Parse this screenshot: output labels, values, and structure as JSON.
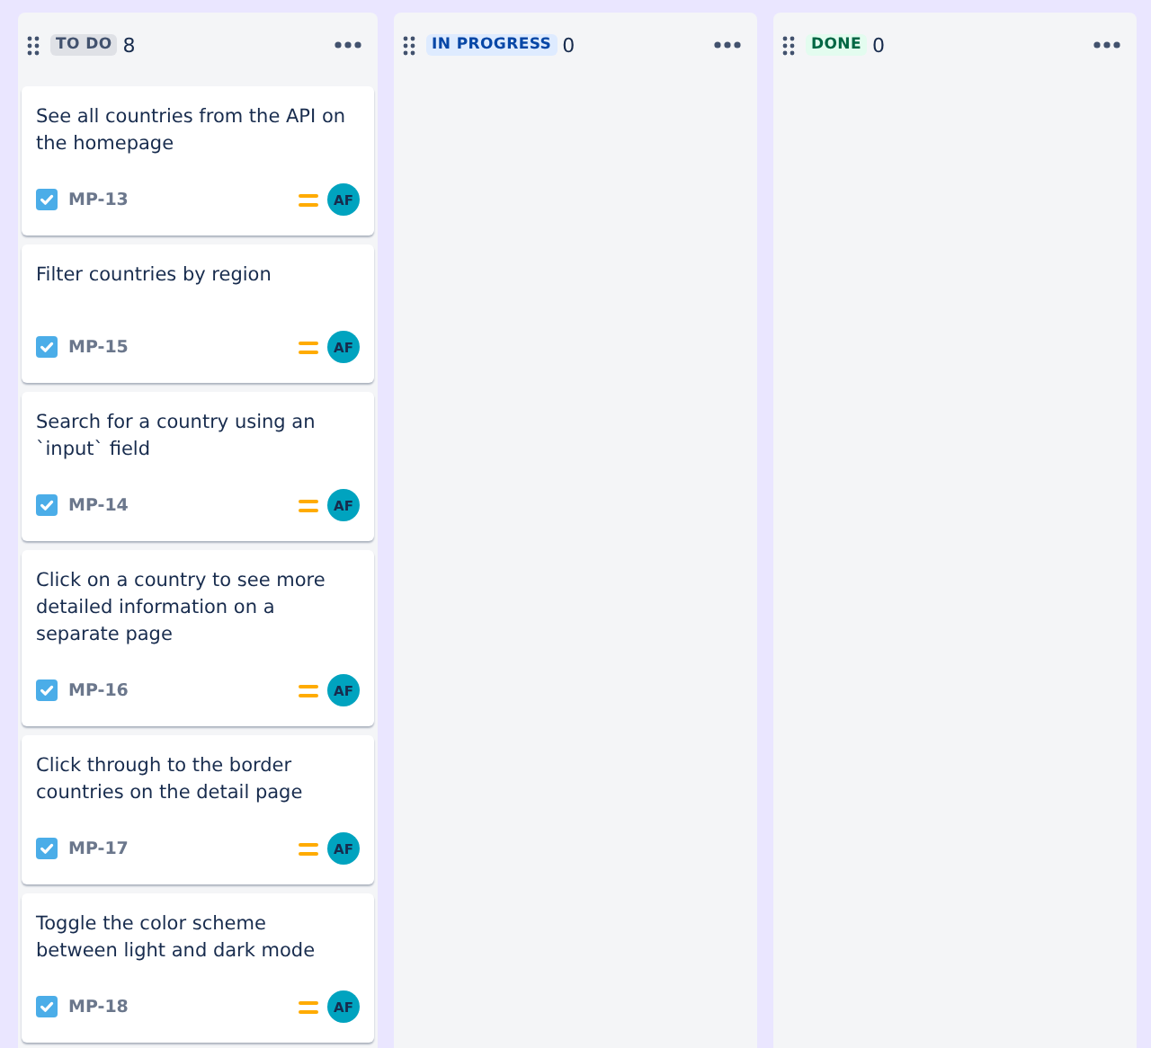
{
  "columns": [
    {
      "status": "TO DO",
      "kind": "todo",
      "count": "8",
      "cards": [
        {
          "title": "See all countries from the API on the homepage",
          "key": "MP-13",
          "assignee": "AF"
        },
        {
          "title": "Filter countries by region",
          "key": "MP-15",
          "assignee": "AF"
        },
        {
          "title": "Search for a country using an `input` field",
          "key": "MP-14",
          "assignee": "AF"
        },
        {
          "title": "Click on a country to see more detailed information on a separate page",
          "key": "MP-16",
          "assignee": "AF"
        },
        {
          "title": "Click through to the border countries on the detail page",
          "key": "MP-17",
          "assignee": "AF"
        },
        {
          "title": "Toggle the color scheme between light and dark mode",
          "key": "MP-18",
          "assignee": "AF"
        }
      ]
    },
    {
      "status": "IN PROGRESS",
      "kind": "inprogress",
      "count": "0"
    },
    {
      "status": "DONE",
      "kind": "done",
      "count": "0"
    }
  ]
}
